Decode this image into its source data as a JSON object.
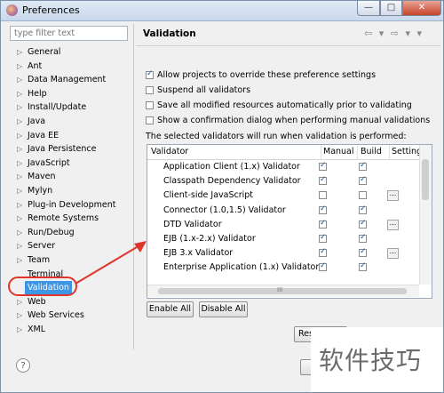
{
  "window": {
    "title": "Preferences",
    "close_glyph": "✕",
    "min_glyph": "—",
    "max_glyph": "□"
  },
  "left": {
    "filter_placeholder": "type filter text",
    "items": [
      {
        "label": "General",
        "arrow": "▷"
      },
      {
        "label": "Ant",
        "arrow": "▷"
      },
      {
        "label": "Data Management",
        "arrow": "▷"
      },
      {
        "label": "Help",
        "arrow": "▷"
      },
      {
        "label": "Install/Update",
        "arrow": "▷"
      },
      {
        "label": "Java",
        "arrow": "▷"
      },
      {
        "label": "Java EE",
        "arrow": "▷"
      },
      {
        "label": "Java Persistence",
        "arrow": "▷"
      },
      {
        "label": "JavaScript",
        "arrow": "▷"
      },
      {
        "label": "Maven",
        "arrow": "▷"
      },
      {
        "label": "Mylyn",
        "arrow": "▷"
      },
      {
        "label": "Plug-in Development",
        "arrow": "▷"
      },
      {
        "label": "Remote Systems",
        "arrow": "▷"
      },
      {
        "label": "Run/Debug",
        "arrow": "▷"
      },
      {
        "label": "Server",
        "arrow": "▷"
      },
      {
        "label": "Team",
        "arrow": "▷"
      },
      {
        "label": "Terminal",
        "arrow": ""
      },
      {
        "label": "Validation",
        "arrow": "",
        "selected": true
      },
      {
        "label": "Web",
        "arrow": "▷"
      },
      {
        "label": "Web Services",
        "arrow": "▷"
      },
      {
        "label": "XML",
        "arrow": "▷"
      }
    ]
  },
  "page": {
    "title": "Validation",
    "nav": "⇦ ▾ ⇨ ▾ ▾",
    "options": [
      {
        "label": "Allow projects to override these preference settings",
        "checked": true
      },
      {
        "label": "Suspend all validators",
        "checked": false
      },
      {
        "label": "Save all modified resources automatically prior to validating",
        "checked": false
      },
      {
        "label": "Show a confirmation dialog when performing manual validations",
        "checked": false
      }
    ],
    "note": "The selected validators will run when validation is performed:"
  },
  "table": {
    "headers": {
      "validator": "Validator",
      "manual": "Manual",
      "build": "Build",
      "settings": "Setting"
    },
    "rows": [
      {
        "name": "Application Client (1.x) Validator",
        "manual": true,
        "build": true,
        "settings": false
      },
      {
        "name": "Classpath Dependency Validator",
        "manual": true,
        "build": true,
        "settings": false
      },
      {
        "name": "Client-side JavaScript",
        "manual": false,
        "build": false,
        "settings": true
      },
      {
        "name": "Connector (1.0,1.5) Validator",
        "manual": true,
        "build": true,
        "settings": false
      },
      {
        "name": "DTD Validator",
        "manual": true,
        "build": true,
        "settings": true
      },
      {
        "name": "EJB (1.x-2.x) Validator",
        "manual": true,
        "build": true,
        "settings": false
      },
      {
        "name": "EJB 3.x Validator",
        "manual": true,
        "build": true,
        "settings": true
      },
      {
        "name": "Enterprise Application (1.x) Validator",
        "manual": true,
        "build": true,
        "settings": false
      }
    ],
    "hscroll_glyph": "III"
  },
  "buttons": {
    "enable_all": "Enable All",
    "disable_all": "Disable All",
    "restore": "Res"
  },
  "help_glyph": "?",
  "watermark": "软件技巧",
  "colors": {
    "selection": "#3d95e6",
    "annotation_red": "#e0352b"
  }
}
